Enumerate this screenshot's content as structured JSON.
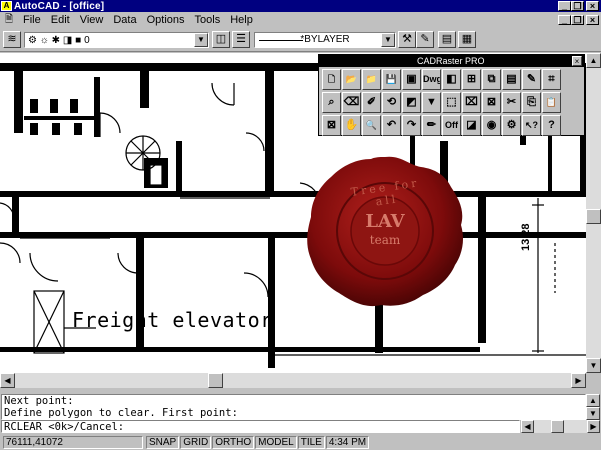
{
  "window": {
    "title": "AutoCAD - [office]",
    "minimize": "_",
    "restore": "❐",
    "close": "×"
  },
  "menu": [
    "File",
    "Edit",
    "View",
    "Data",
    "Options",
    "Tools",
    "Help"
  ],
  "properties_toolbar": {
    "layer_name": "0",
    "linetype": "BYLAYER",
    "linetype_display": "*BYLAYER"
  },
  "drawing": {
    "label_freight": "Freight elevator",
    "dimension": "13.28",
    "seal_text_top": "Tree for all",
    "seal_text_center_1": "LAV",
    "seal_text_center_2": "team"
  },
  "cadraster": {
    "title": "CADRaster PRO",
    "tools": [
      {
        "name": "new-icon",
        "glyph": "🗋"
      },
      {
        "name": "open-icon",
        "glyph": "📂"
      },
      {
        "name": "open-folder-icon",
        "glyph": "📁"
      },
      {
        "name": "save-icon",
        "glyph": "💾"
      },
      {
        "name": "insert-image-icon",
        "glyph": "▣"
      },
      {
        "name": "dwg-icon",
        "glyph": "Dwg"
      },
      {
        "name": "image-frame-icon",
        "glyph": "◧"
      },
      {
        "name": "calibrate-icon",
        "glyph": "⊞"
      },
      {
        "name": "clip-icon",
        "glyph": "⧉"
      },
      {
        "name": "image-window-icon",
        "glyph": "▤"
      },
      {
        "name": "hand-draw-icon",
        "glyph": "✎"
      },
      {
        "name": "grid-icon",
        "glyph": "⌗"
      },
      {
        "name": "spacer",
        "glyph": ""
      },
      {
        "name": "zoom-image-icon",
        "glyph": "⌕"
      },
      {
        "name": "erase-icon",
        "glyph": "⌫"
      },
      {
        "name": "pen-erase-icon",
        "glyph": "✐"
      },
      {
        "name": "rotate-icon",
        "glyph": "⟲"
      },
      {
        "name": "invert-icon",
        "glyph": "◩"
      },
      {
        "name": "filter-icon",
        "glyph": "▼"
      },
      {
        "name": "transform-icon",
        "glyph": "⬚"
      },
      {
        "name": "crop-icon",
        "glyph": "⌧"
      },
      {
        "name": "delete-raster-icon",
        "glyph": "⊠"
      },
      {
        "name": "cut-icon",
        "glyph": "✂"
      },
      {
        "name": "copy-icon",
        "glyph": "⎘"
      },
      {
        "name": "paste-icon",
        "glyph": "📋"
      },
      {
        "name": "spacer",
        "glyph": ""
      },
      {
        "name": "clear-icon",
        "glyph": "⊠"
      },
      {
        "name": "pan-hand-icon",
        "glyph": "✋"
      },
      {
        "name": "zoom-icon",
        "glyph": "🔍"
      },
      {
        "name": "undo-icon",
        "glyph": "↶"
      },
      {
        "name": "redo-icon",
        "glyph": "↷"
      },
      {
        "name": "pencil-icon",
        "glyph": "✏"
      },
      {
        "name": "off-icon",
        "glyph": "Off"
      },
      {
        "name": "contrast-icon",
        "glyph": "◪"
      },
      {
        "name": "target-icon",
        "glyph": "◉"
      },
      {
        "name": "grid-settings-icon",
        "glyph": "⚙"
      },
      {
        "name": "pointer-help-icon",
        "glyph": "↖?"
      },
      {
        "name": "help-icon",
        "glyph": "?"
      },
      {
        "name": "spacer",
        "glyph": ""
      }
    ]
  },
  "command": {
    "history": [
      "Next point:",
      "Define polygon to clear. First point:"
    ],
    "prompt": "RCLEAR <0k>/Cancel:"
  },
  "status": {
    "coords": "76111,41072",
    "snap": "SNAP",
    "grid": "GRID",
    "ortho": "ORTHO",
    "model": "MODEL",
    "tile": "TILE",
    "time": "4:34 PM"
  },
  "colors": {
    "titlebar": "#000080",
    "seal": "#8b0a0a",
    "chrome": "#c0c0c0"
  }
}
